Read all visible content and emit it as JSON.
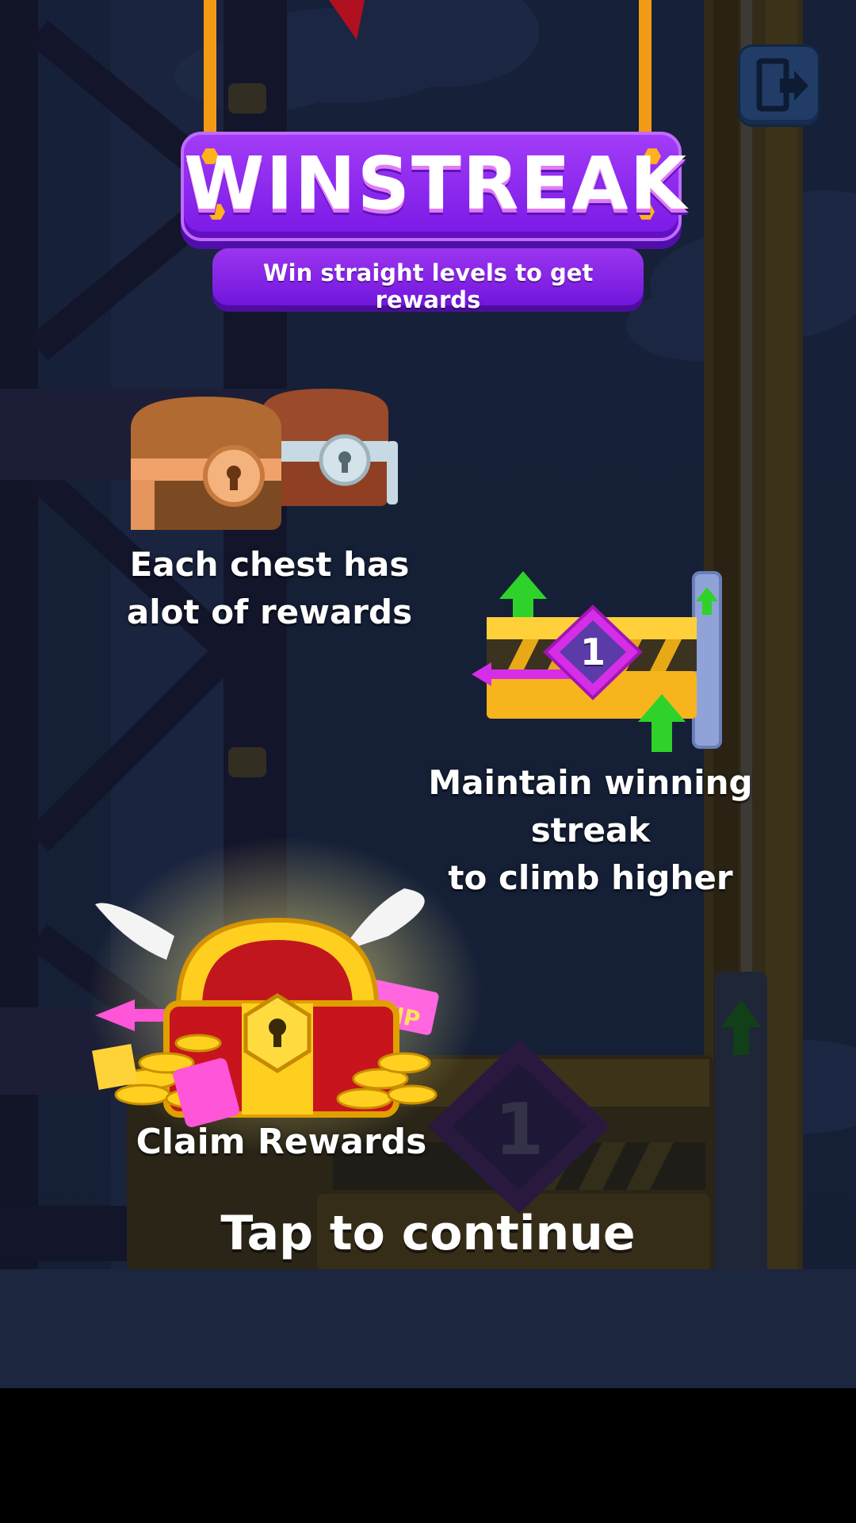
{
  "header": {
    "title": "WINSTREAK",
    "subtitle": "Win straight levels to get rewards"
  },
  "features": [
    {
      "text_line1": "Each chest has",
      "text_line2": "alot of rewards",
      "icon": "twin-chests-icon"
    },
    {
      "text_line1": "Maintain winning streak",
      "text_line2": "to climb higher",
      "icon": "streak-platform-icon",
      "badge_number": "1"
    },
    {
      "text": "Claim Rewards",
      "icon": "winged-treasure-chest-icon"
    }
  ],
  "background": {
    "platform_number": "1"
  },
  "exit_button": {
    "icon": "exit-door-icon"
  },
  "footer": {
    "prompt": "Tap to continue"
  },
  "colors": {
    "sign_purple": "#8a26ee",
    "hex_orange": "#ffb21c",
    "platform_yellow": "#f7b41c",
    "arrow_green": "#2ed22a",
    "badge_magenta": "#d52ee6"
  }
}
